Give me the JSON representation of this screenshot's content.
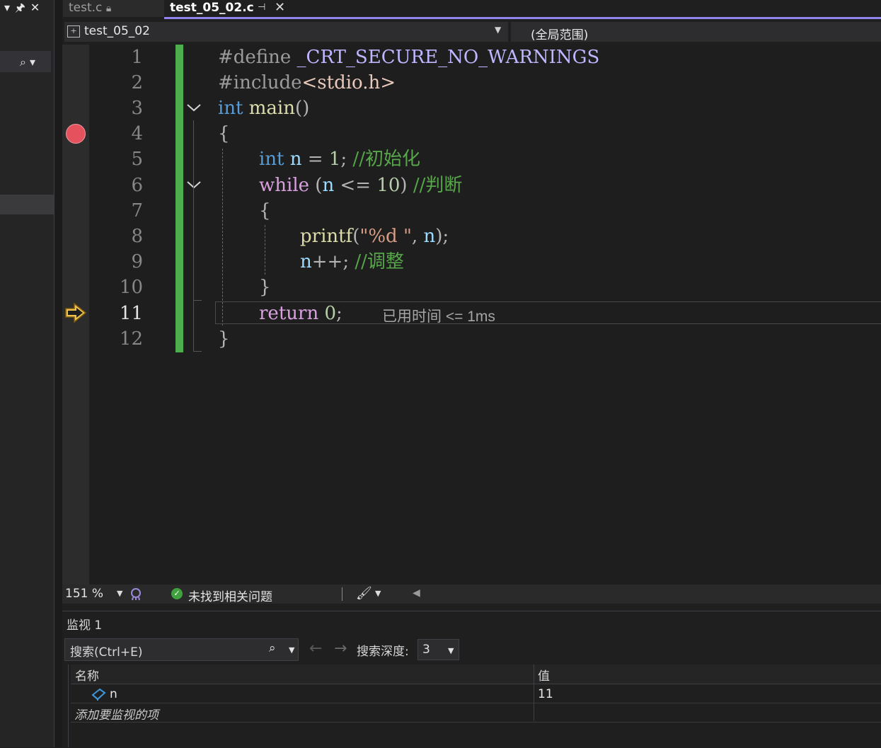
{
  "left_panel": {
    "pin_glyph": "⊥",
    "close_glyph": "✕",
    "dropdown_glyph": "▾",
    "search_icon": "search-icon"
  },
  "tabs": [
    {
      "label": "test.c",
      "locked": true,
      "active": false
    },
    {
      "label": "test_05_02.c",
      "active": true,
      "pin": "⊣",
      "close": "✕"
    }
  ],
  "nav": {
    "file_label": "test_05_02",
    "scope_label": "(全局范围)"
  },
  "editor": {
    "line_numbers": [
      "1",
      "2",
      "3",
      "4",
      "5",
      "6",
      "7",
      "8",
      "9",
      "10",
      "11",
      "12"
    ],
    "current_line": "11",
    "breakpoint_line": "4",
    "perf_tip": "已用时间 <= 1ms",
    "code": {
      "l1_directive": "#define",
      "l1_macro": " _CRT_SECURE_NO_WARNINGS",
      "l2_directive": "#include",
      "l2_header": "<stdio.h>",
      "l3_kw": "int",
      "l3_fn": " main",
      "l3_paren": "()",
      "l4": "{",
      "l5_kw": "int",
      "l5_var": " n",
      "l5_op": " = ",
      "l5_num": "1",
      "l5_semi": ";",
      "l5_cmt": " //初始化",
      "l6_kw": "while",
      "l6_p1": " (",
      "l6_var": "n",
      "l6_op": " <= ",
      "l6_num": "10",
      "l6_p2": ")",
      "l6_cmt": " //判断",
      "l7": "{",
      "l8_fn": "printf",
      "l8_p1": "(",
      "l8_str": "\"%d \"",
      "l8_comma": ", ",
      "l8_var": "n",
      "l8_p2": ");",
      "l9_var": "n",
      "l9_op": "++;",
      "l9_cmt": " //调整",
      "l10": "}",
      "l11_kw": "return",
      "l11_num": " 0",
      "l11_semi": ";",
      "l12": "}"
    }
  },
  "status": {
    "zoom": "151 %",
    "issues_text": "未找到相关问题",
    "issues_check": "✓"
  },
  "watch": {
    "title": "监视 1",
    "search_placeholder": "搜索(Ctrl+E)",
    "back": "←",
    "forward": "→",
    "depth_label": "搜索深度:",
    "depth_value": "3",
    "columns": [
      "名称",
      "值"
    ],
    "rows": [
      {
        "name": "n",
        "value": "11"
      }
    ],
    "add_item_text": "添加要监视的项"
  },
  "colors": {
    "accent": "#9184ee",
    "change_bar": "#4cae4c",
    "breakpoint": "#e6515e",
    "exec_arrow": "#f0c24b"
  }
}
